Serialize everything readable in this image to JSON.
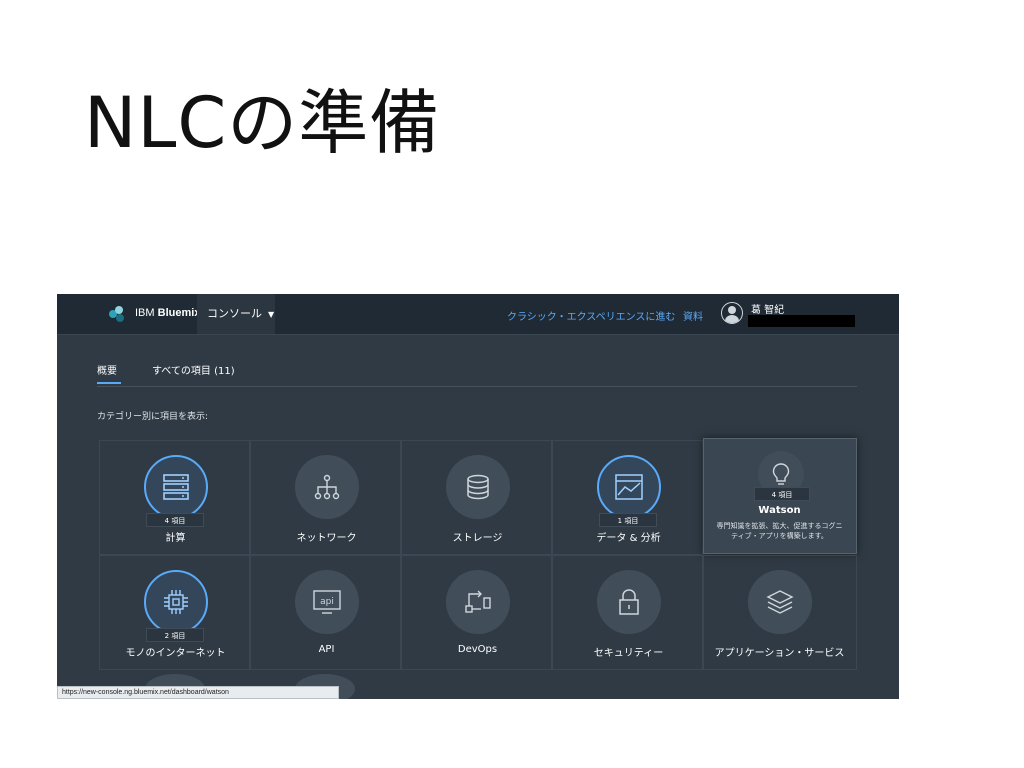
{
  "slide": {
    "title": "NLCの準備"
  },
  "header": {
    "brand_prefix": "IBM",
    "brand_name": "Bluemix",
    "console_label": "コンソール",
    "classic_link": "クラシック・エクスペリエンスに進む",
    "docs_link": "資料",
    "user_name": "葛 智紀"
  },
  "tabs": [
    {
      "label": "概要"
    },
    {
      "label": "すべての項目 (11)"
    }
  ],
  "category_label": "カテゴリー別に項目を表示:",
  "tiles": [
    {
      "name": "計算",
      "badge": "4 項目",
      "icon": "server-stack-icon"
    },
    {
      "name": "ネットワーク",
      "badge": "",
      "icon": "network-icon"
    },
    {
      "name": "ストレージ",
      "badge": "",
      "icon": "database-icon"
    },
    {
      "name": "データ & 分析",
      "badge": "1 項目",
      "icon": "chart-icon"
    },
    {
      "name": "Watson",
      "badge": "4 項目",
      "icon": "lightbulb-icon",
      "description": "専門知識を拡張、拡大、促進するコグニティブ・アプリを構築します。"
    },
    {
      "name": "モノのインターネット",
      "badge": "2 項目",
      "icon": "chip-icon"
    },
    {
      "name": "API",
      "badge": "",
      "icon": "api-icon"
    },
    {
      "name": "DevOps",
      "badge": "",
      "icon": "pipeline-icon"
    },
    {
      "name": "セキュリティー",
      "badge": "",
      "icon": "lock-icon"
    },
    {
      "name": "アプリケーション・サービス",
      "badge": "",
      "icon": "layers-icon"
    }
  ],
  "status_url": "https://new-console.ng.bluemix.net/dashboard/watson",
  "colors": {
    "accent": "#5aaafa",
    "bg": "#2f3a44",
    "topbar": "#1f2a34"
  }
}
